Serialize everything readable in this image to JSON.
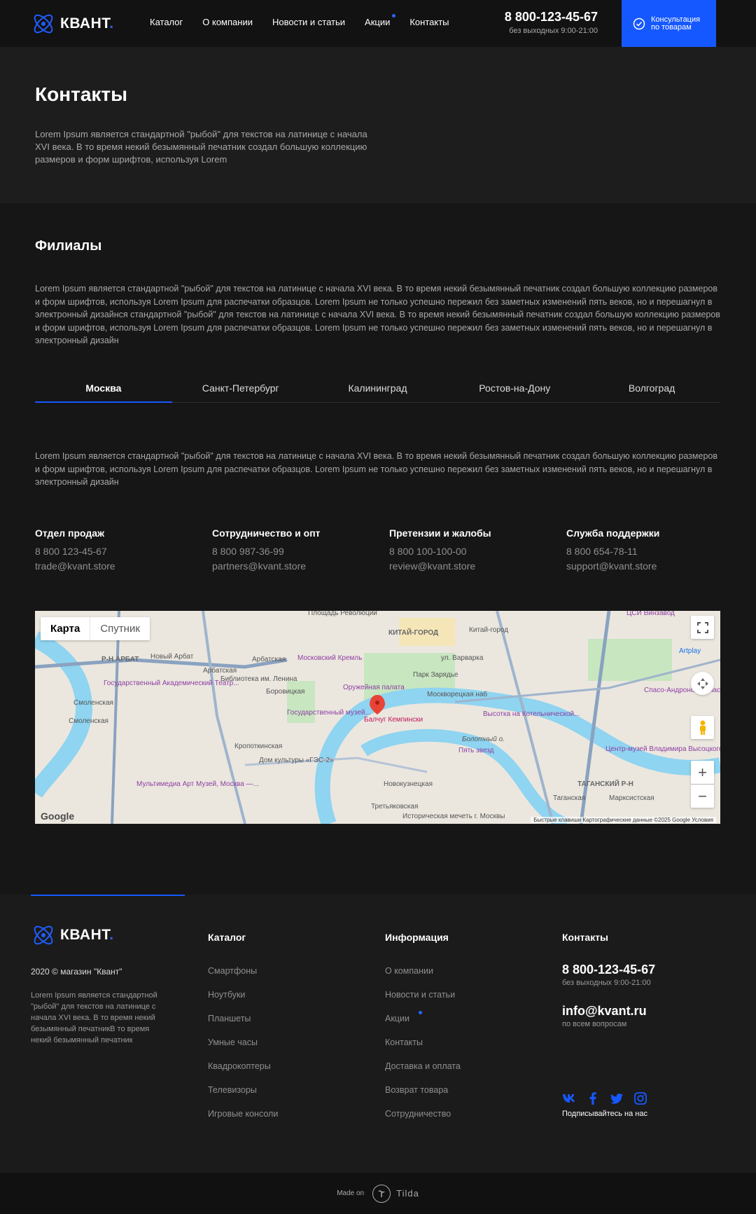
{
  "header": {
    "logo_text": "КВАНТ",
    "logo_dot": ".",
    "nav": [
      {
        "label": "Каталог"
      },
      {
        "label": "О компании"
      },
      {
        "label": "Новости и статьи"
      },
      {
        "label": "Акции"
      },
      {
        "label": "Контакты"
      }
    ],
    "phone": "8 800-123-45-67",
    "phone_hours": "без выходных 9:00-21:00",
    "consult_label": "Консультация по товарам"
  },
  "hero": {
    "title": "Контакты",
    "text": "Lorem Ipsum является стандартной \"рыбой\" для текстов на латинице с начала XVI века. В то время некий безымянный печатник создал большую коллекцию размеров и форм шрифтов, используя Lorem"
  },
  "branches": {
    "title": "Филиалы",
    "intro": "Lorem Ipsum является стандартной \"рыбой\" для текстов на латинице с начала XVI века. В то время некий безымянный печатник создал большую коллекцию размеров и форм шрифтов, используя Lorem Ipsum для распечатки образцов. Lorem Ipsum не только успешно пережил без заметных изменений пять веков, но и перешагнул в электронный дизайнся стандартной \"рыбой\" для текстов на латинице с начала XVI века. В то время некий безымянный печатник создал большую коллекцию размеров и форм шрифтов, используя Lorem Ipsum для распечатки образцов. Lorem Ipsum не только успешно пережил без заметных изменений пять веков, но и перешагнул в электронный дизайн",
    "tabs": [
      "Москва",
      "Санкт-Петербург",
      "Калининград",
      "Ростов-на-Дону",
      "Волгоград"
    ],
    "active_tab": "Москва",
    "city_description": "Lorem Ipsum является стандартной \"рыбой\" для текстов на латинице с начала XVI века. В то время некий безымянный печатник создал большую коллекцию размеров и форм шрифтов, используя Lorem Ipsum для распечатки образцов. Lorem Ipsum не только успешно пережил без заметных изменений пять веков, но и перешагнул в электронный дизайн",
    "departments": [
      {
        "title": "Отдел продаж",
        "phone": "8 800 123-45-67",
        "email": "trade@kvant.store"
      },
      {
        "title": "Сотрудничество и опт",
        "phone": "8 800 987-36-99",
        "email": "partners@kvant.store"
      },
      {
        "title": "Претензии и жалобы",
        "phone": "8 800 100-100-00",
        "email": "review@kvant.store"
      },
      {
        "title": "Служба поддержки",
        "phone": "8 800 654-78-11",
        "email": "support@kvant.store"
      }
    ]
  },
  "map": {
    "type_map": "Карта",
    "type_satellite": "Спутник",
    "attribution": "Быстрые клавиши   Картографические данные ©2025 Google   Условия",
    "google": "Google",
    "labels": [
      "Площадь Революции",
      "Китай-город",
      "ЦСИ Винзавод",
      "КИТАЙ-ГОРОД",
      "Р-Н АРБАТ",
      "Новый Арбат",
      "Арбатская",
      "Арбатская",
      "Московский Кремль",
      "ул. Варварка",
      "Библиотека им. Ленина",
      "Парк Зарядье",
      "Государственный Академический Театр...",
      "Боровицкая",
      "Оружейная палата",
      "Спасо-Андронов монастырь",
      "Смоленская",
      "Государственный музей...",
      "Москворецкая наб",
      "Высотка на Котельнической...",
      "Смоленская",
      "Балчуг Кемпински",
      "Болотный о.",
      "Кропоткинская",
      "Пять звезд",
      "Центр-музей Владимира Высоцкого",
      "Дом культуры «ГЭС-2»",
      "ТАГАНСКИЙ Р-Н",
      "Мультимедиа Арт Музей, Москва —...",
      "Новокузнецкая",
      "Таганская",
      "Марксистская",
      "Третьяковская",
      "Историческая мечеть г. Москвы",
      "Artplay"
    ]
  },
  "footer": {
    "logo_text": "КВАНТ",
    "copyright": "2020 © магазин \"Квант\"",
    "about": "Lorem Ipsum является стандартной \"рыбой\" для текстов на латинице с начала XVI века. В то время некий безымянный печатникВ то время некий безымянный печатник",
    "catalog_title": "Каталог",
    "catalog_links": [
      "Смартфоны",
      "Ноутбуки",
      "Планшеты",
      "Умные часы",
      "Квадрокоптеры",
      "Телевизоры",
      "Игровые консоли"
    ],
    "info_title": "Информация",
    "info_links": [
      "О компании",
      "Новости и статьи",
      "Акции",
      "Контакты",
      "Доставка и оплата",
      "Возврат товара",
      "Сотрудничество"
    ],
    "contacts_title": "Контакты",
    "phone": "8 800-123-45-67",
    "phone_hours": "без выходных 9:00-21:00",
    "email": "info@kvant.ru",
    "email_sub": "по всем вопросам",
    "subscribe": "Подписывайтесь на нас",
    "socials": [
      "vk-icon",
      "facebook-icon",
      "twitter-icon",
      "instagram-icon"
    ],
    "accent_color": "#1658ff"
  },
  "bottom": {
    "made_on": "Made on",
    "tilda": "Tilda"
  }
}
